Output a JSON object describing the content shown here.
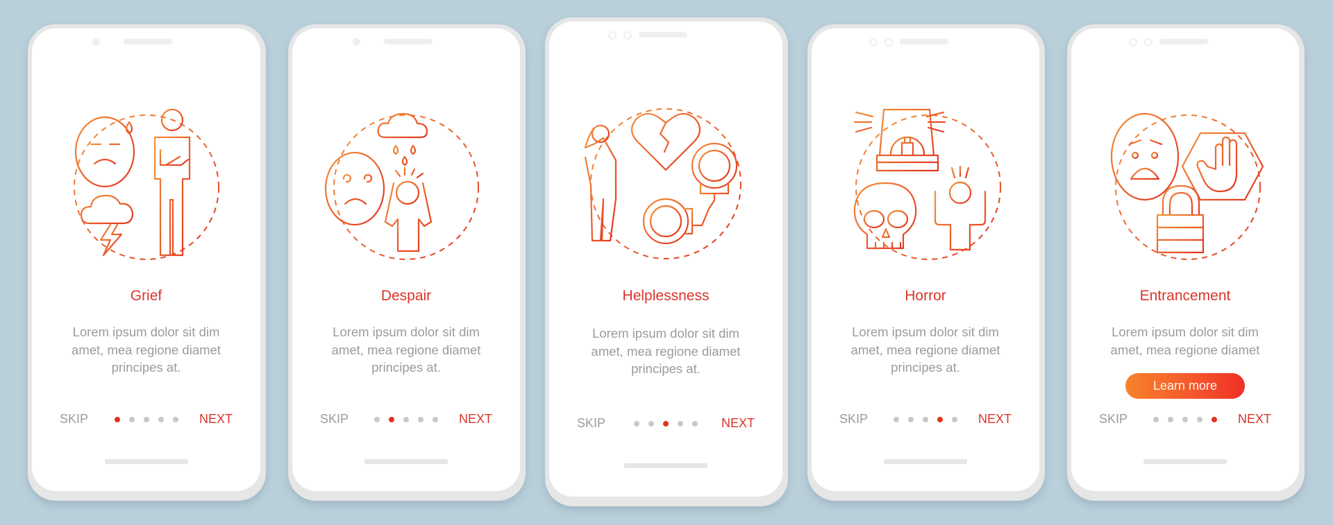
{
  "theme": {
    "background": "#b9cfda",
    "accent": "#d9352a",
    "gradient_start": "#f7822b",
    "gradient_end": "#e3321f",
    "muted_text": "#9b9b9b",
    "dot_inactive": "#c8c8c8"
  },
  "nav": {
    "skip_label": "SKIP",
    "next_label": "NEXT",
    "total_pages": 5
  },
  "screens": [
    {
      "title": "Grief",
      "body": "Lorem ipsum dolor sit dim amet, mea regione diamet principes at.",
      "active_page": 1,
      "illustration": [
        "sad-face-with-sweat-icon",
        "person-arms-crossed-icon",
        "storm-cloud-lightning-icon"
      ]
    },
    {
      "title": "Despair",
      "body": "Lorem ipsum dolor sit dim amet, mea regione diamet principes at.",
      "active_page": 2,
      "illustration": [
        "dizzy-sad-face-icon",
        "rain-cloud-icon",
        "stressed-person-holding-head-icon"
      ]
    },
    {
      "title": "Helplessness",
      "body": "Lorem ipsum dolor sit dim amet, mea regione diamet principes at.",
      "active_page": 3,
      "illustration": [
        "broken-heart-icon",
        "distressed-person-icon",
        "handcuffs-icon"
      ]
    },
    {
      "title": "Horror",
      "body": "Lorem ipsum dolor sit dim amet, mea regione diamet principes at.",
      "active_page": 4,
      "illustration": [
        "alarm-siren-icon",
        "skull-icon",
        "scared-person-exclamation-icon"
      ]
    },
    {
      "title": "Entrancement",
      "body": "Lorem ipsum dolor sit dim amet, mea regione diamet",
      "active_page": 5,
      "button_label": "Learn more",
      "illustration": [
        "worried-face-icon",
        "stop-hand-hexagon-icon",
        "padlock-icon"
      ]
    }
  ]
}
